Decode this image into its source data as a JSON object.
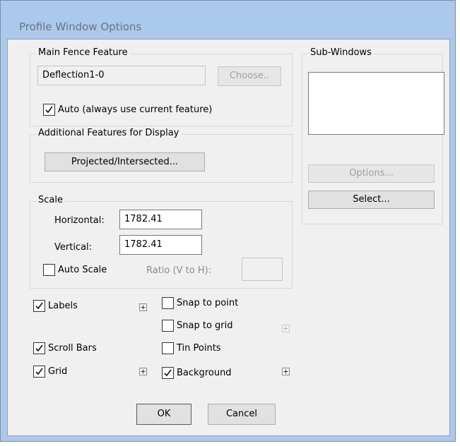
{
  "window": {
    "title": "Profile Window Options"
  },
  "main_fence": {
    "legend": "Main Fence Feature",
    "feature_value": "Deflection1-0",
    "choose_label": "Choose..",
    "auto_label": "Auto (always use current feature)",
    "auto_checked": true
  },
  "additional": {
    "legend": "Additional Features for Display",
    "projected_label": "Projected/Intersected..."
  },
  "scale": {
    "legend": "Scale",
    "horizontal_label": "Horizontal:",
    "horizontal_value": "1782.41",
    "vertical_label": "Vertical:",
    "vertical_value": "1782.41",
    "auto_scale_label": "Auto Scale",
    "auto_scale_checked": false,
    "ratio_label": "Ratio (V to H):",
    "ratio_value": ""
  },
  "sub_windows": {
    "legend": "Sub-Windows",
    "options_label": "Options...",
    "select_label": "Select..."
  },
  "options": {
    "labels": {
      "label": "Labels",
      "checked": true
    },
    "snap_to_point": {
      "label": "Snap to point",
      "checked": false
    },
    "snap_to_grid": {
      "label": "Snap to grid",
      "checked": false
    },
    "scroll_bars": {
      "label": "Scroll Bars",
      "checked": true
    },
    "tin_points": {
      "label": "Tin Points",
      "checked": false
    },
    "grid": {
      "label": "Grid",
      "checked": true
    },
    "background": {
      "label": "Background",
      "checked": true
    }
  },
  "buttons": {
    "ok": "OK",
    "cancel": "Cancel"
  }
}
